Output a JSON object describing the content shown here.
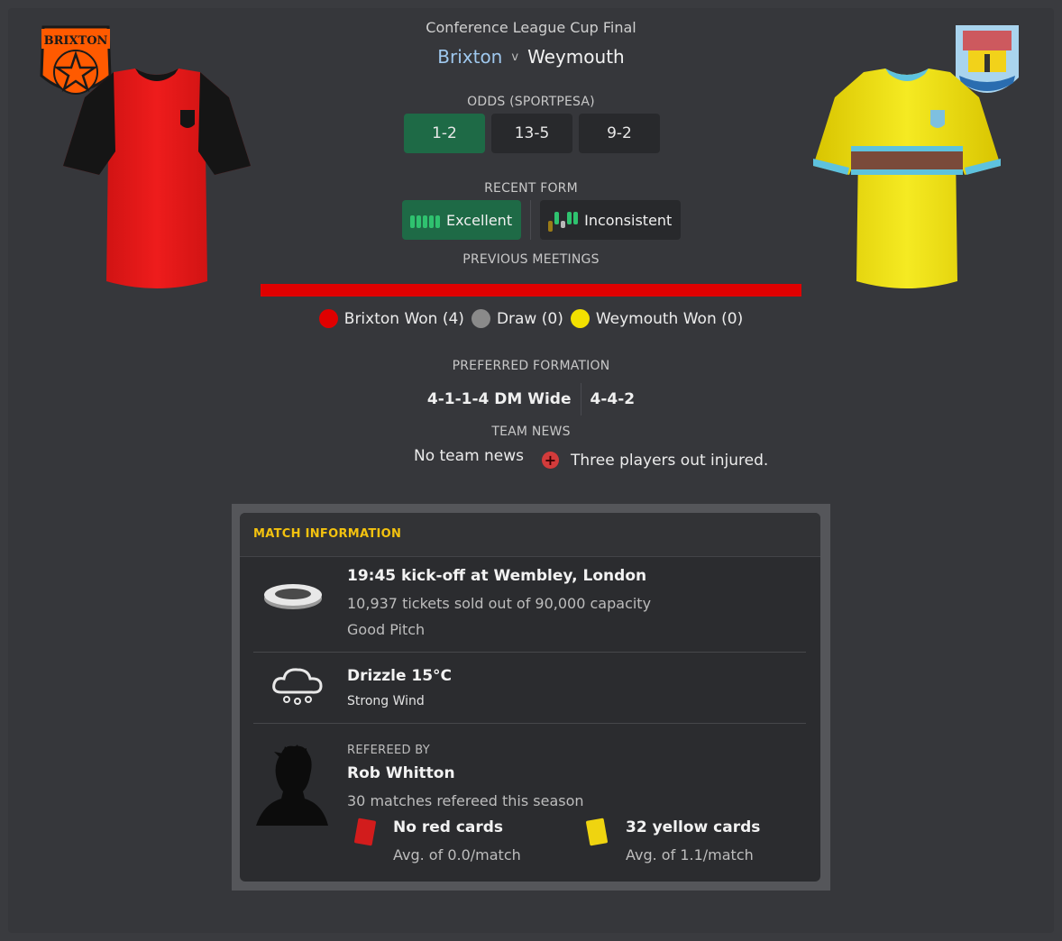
{
  "competition": "Conference League Cup Final",
  "home_team": "Brixton",
  "versus": "v",
  "away_team": "Weymouth",
  "home_badge_text": "BRIXTON",
  "odds": {
    "label": "ODDS (SPORTPESA)",
    "home": "1-2",
    "draw": "13-5",
    "away": "9-2"
  },
  "recent_form": {
    "label": "RECENT FORM",
    "home": "Excellent",
    "away": "Inconsistent",
    "home_bars": [
      "W",
      "W",
      "W",
      "W",
      "W"
    ],
    "away_bars": [
      "L",
      "W",
      "D",
      "W",
      "W"
    ]
  },
  "previous_meetings": {
    "label": "PREVIOUS MEETINGS",
    "home_won": "Brixton Won (4)",
    "draw": "Draw (0)",
    "away_won": "Weymouth Won (0)",
    "home_wins": 4,
    "draws": 0,
    "away_wins": 0
  },
  "preferred_formation": {
    "label": "PREFERRED FORMATION",
    "home": "4-1-1-4 DM Wide",
    "away": "4-4-2"
  },
  "team_news": {
    "label": "TEAM NEWS",
    "home": "No team news",
    "away": "Three players out injured."
  },
  "match_information": {
    "title": "MATCH INFORMATION",
    "kickoff": "19:45 kick-off at Wembley, London",
    "tickets": "10,937 tickets sold out of 90,000 capacity",
    "pitch": "Good Pitch",
    "weather": "Drizzle 15°C",
    "wind": "Strong Wind",
    "referee_label": "REFEREED BY",
    "referee_name": "Rob Whitton",
    "referee_matches": "30 matches refereed this season",
    "red_cards": "No red cards",
    "red_avg": "Avg. of 0.0/match",
    "yellow_cards": "32 yellow cards",
    "yellow_avg": "Avg. of 1.1/match"
  },
  "colors": {
    "home_primary": "#e00000",
    "away_primary": "#f2e000",
    "draw": "#8a8a8a",
    "odds_best": "#1e6a46",
    "form_win": "#2fc26f",
    "form_loss": "#9a7b17",
    "accent_title": "#f3c20f"
  }
}
